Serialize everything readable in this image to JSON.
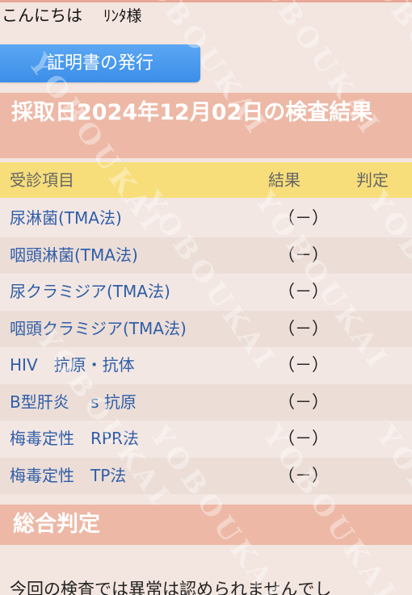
{
  "greeting": {
    "hello": "こんにちは",
    "user": "ﾘﾝﾀ様"
  },
  "issue_button": {
    "label": "証明書の発行"
  },
  "results": {
    "title": "採取日2024年12月02日の検査結果",
    "columns": {
      "item": "受診項目",
      "result": "結果",
      "judgement": "判定"
    },
    "rows": [
      {
        "item": "尿淋菌(TMA法)",
        "result": "（－）",
        "judgement": ""
      },
      {
        "item": "咽頭淋菌(TMA法)",
        "result": "（－）",
        "judgement": ""
      },
      {
        "item": "尿クラミジア(TMA法)",
        "result": "（－）",
        "judgement": ""
      },
      {
        "item": "咽頭クラミジア(TMA法)",
        "result": "（－）",
        "judgement": ""
      },
      {
        "item": "HIV　抗原・抗体",
        "result": "（－）",
        "judgement": ""
      },
      {
        "item": "B型肝炎　 s 抗原",
        "result": "（－）",
        "judgement": ""
      },
      {
        "item": "梅毒定性　RPR法",
        "result": "（－）",
        "judgement": ""
      },
      {
        "item": "梅毒定性　TP法",
        "result": "（－）",
        "judgement": ""
      }
    ]
  },
  "overall": {
    "title": "総合判定",
    "text": "今回の検査では異常は認められませんでし"
  },
  "watermark": "YOBOUKAI",
  "colors": {
    "section_header": "#edb8a6",
    "column_header": "#f7de7a",
    "button": "#4a9af0",
    "item_text": "#2f5ea8"
  }
}
